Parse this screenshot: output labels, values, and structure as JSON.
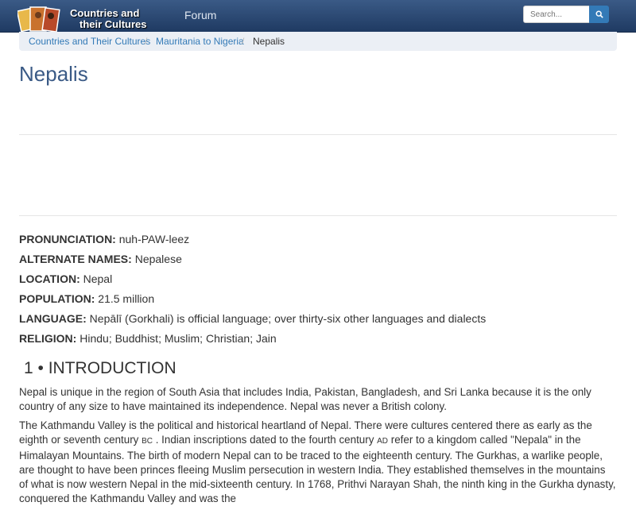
{
  "header": {
    "logo_line1": "Countries and",
    "logo_line2": "their Cultures",
    "nav_forum": "Forum",
    "search_placeholder": "Search..."
  },
  "breadcrumb": [
    "Countries and Their Cultures",
    "Mauritania to Nigeria",
    "Nepalis"
  ],
  "page_title": "Nepalis",
  "facts": [
    {
      "label": "PRONUNCIATION:",
      "value": "nuh-PAW-leez"
    },
    {
      "label": "ALTERNATE NAMES:",
      "value": "Nepalese"
    },
    {
      "label": "LOCATION:",
      "value": "Nepal"
    },
    {
      "label": "POPULATION:",
      "value": "21.5 million"
    },
    {
      "label": "LANGUAGE:",
      "value": "Nepālī (Gorkhali) is official language; over thirty-six other languages and dialects"
    },
    {
      "label": "RELIGION:",
      "value": "Hindu; Buddhist; Muslim; Christian; Jain"
    }
  ],
  "section_title": "1 • INTRODUCTION",
  "paragraphs": {
    "p1": "Nepal is unique in the region of South Asia that includes India, Pakistan, Bangladesh, and Sri Lanka because it is the only country of any size to have maintained its independence. Nepal was never a British colony.",
    "p2_a": "The Kathmandu Valley is the political and historical heartland of Nepal. There were cultures centered there as early as the eighth or seventh century ",
    "p2_bc": "BC",
    "p2_b": " . Indian inscriptions dated to the fourth century ",
    "p2_ad": "AD",
    "p2_c": " refer to a kingdom called \"Nepala\" in the Himalayan Mountains. The birth of modern Nepal can to be traced to the eighteenth century. The Gurkhas, a warlike people, are thought to have been princes fleeing Muslim persecution in western India. They established themselves in the mountains of what is now western Nepal in the mid-sixteenth century. In 1768, Prithvi Narayan Shah, the ninth king in the Gurkha dynasty, conquered the Kathmandu Valley and was the"
  },
  "colors": {
    "nav_bg": "#2b4a74",
    "link": "#337ab7",
    "title": "#3a5a86",
    "breadcrumb_bg": "#ebeff5"
  }
}
